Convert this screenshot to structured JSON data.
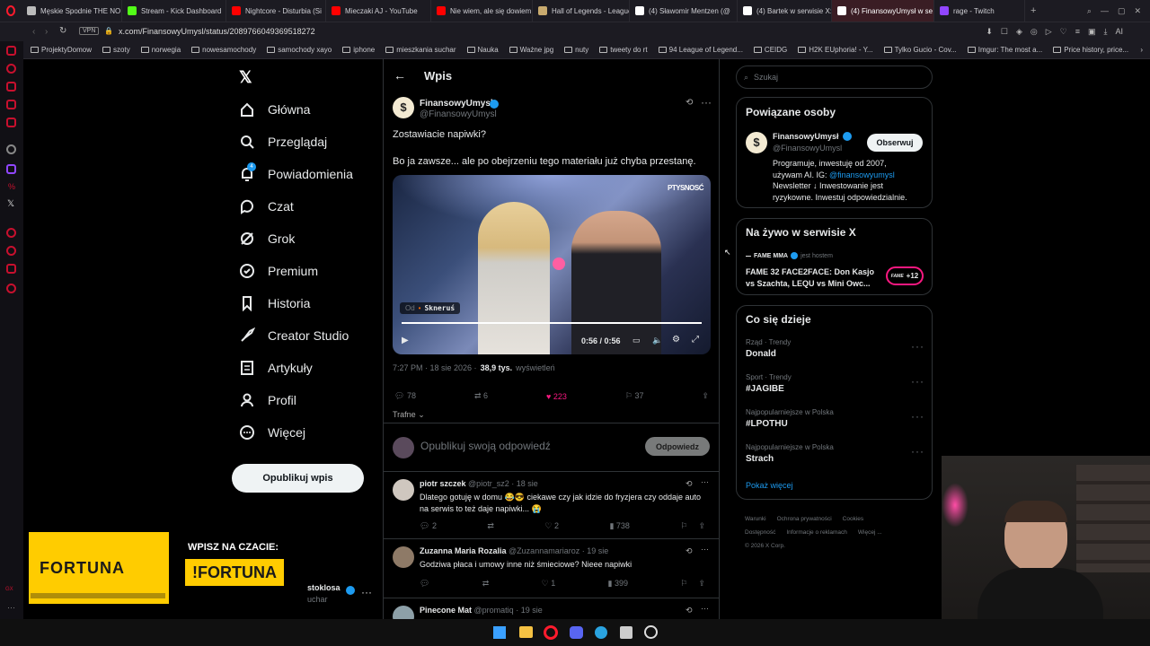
{
  "browser": {
    "tabs": [
      {
        "label": "Męskie Spodnie THE NO",
        "color": "#bbbbbb"
      },
      {
        "label": "Stream - Kick Dashboard",
        "color": "#53fc18"
      },
      {
        "label": "Nightcore - Disturbia (Si",
        "color": "#ff0000"
      },
      {
        "label": "Mieczaki AJ - YouTube",
        "color": "#ff0000"
      },
      {
        "label": "Nie wiem, ale się dowiem",
        "color": "#ff0000"
      },
      {
        "label": "Hall of Legends - League",
        "color": "#c8aa6e"
      },
      {
        "label": "(4) Sławomir Mentzen (@",
        "color": "#ffffff"
      },
      {
        "label": "(4) Bartek w serwisie X:",
        "color": "#ffffff"
      },
      {
        "label": "(4) FinansowyUmysł w se",
        "color": "#ffffff"
      },
      {
        "label": "rage - Twitch",
        "color": "#9146ff"
      }
    ],
    "vpn_label": "VPN",
    "url": "x.com/FinansowyUmysl/status/2089766049369518272",
    "ai_label": "AI",
    "bookmarks": [
      "ProjektyDomow",
      "szoty",
      "norwegia",
      "nowesamochody",
      "samochody xayo",
      "iphone",
      "mieszkania suchar",
      "Nauka",
      "Ważne jpg",
      "nuty",
      "tweety do rt",
      "94 League of Legend...",
      "CEIDG",
      "H2K EUphoria! - Y...",
      "Tylko Gucio - Cov...",
      "Imgur: The most a...",
      "Price history, price..."
    ]
  },
  "nav": {
    "items": [
      {
        "label": "Główna",
        "icon": "home-icon"
      },
      {
        "label": "Przeglądaj",
        "icon": "search-icon"
      },
      {
        "label": "Powiadomienia",
        "icon": "bell-icon",
        "badge": "4"
      },
      {
        "label": "Czat",
        "icon": "chat-icon"
      },
      {
        "label": "Grok",
        "icon": "grok-icon"
      },
      {
        "label": "Premium",
        "icon": "premium-icon"
      },
      {
        "label": "Historia",
        "icon": "bookmark-icon"
      },
      {
        "label": "Creator Studio",
        "icon": "rocket-icon"
      },
      {
        "label": "Artykuły",
        "icon": "article-icon"
      },
      {
        "label": "Profil",
        "icon": "profile-icon"
      },
      {
        "label": "Więcej",
        "icon": "more-icon"
      }
    ],
    "post_button": "Opublikuj wpis",
    "account_name": "stoklosa",
    "account_handle": "uchar"
  },
  "main": {
    "header_title": "Wpis",
    "author_name": "FinansowyUmysł",
    "author_handle": "@FinansowyUmysl",
    "text_line1": "Zostawiacie napiwki?",
    "text_line2": "Bo ja zawsze... ale po obejrzeniu tego materiału już chyba przestanę.",
    "video": {
      "from_label": "Od",
      "from_name": "Skneruś",
      "time": "0:56 / 0:56",
      "watermark": "PTYSNOSĆ",
      "progress": 1.0
    },
    "meta_time": "7:27 PM · 18 sie 2026 ·",
    "meta_views": "38,9 tys.",
    "meta_views_label": "wyświetleń",
    "stats": {
      "replies": "78",
      "reposts": "6",
      "likes": "223",
      "bookmarks": "37"
    },
    "sort_label": "Trafne",
    "reply_placeholder": "Opublikuj swoją odpowiedź",
    "reply_button": "Odpowiedz",
    "replies": [
      {
        "name": "piotr szczek",
        "handle": "@piotr_sz2",
        "date": "· 18 sie",
        "text": "Dlatego gotuję w domu 😂😎 ciekawe czy jak idzie do fryzjera czy oddaje auto na serwis to też daje napiwki... 😭",
        "replies": "2",
        "likes": "2",
        "views": "738"
      },
      {
        "name": "Zuzanna Maria Rozalia",
        "handle": "@Zuzannamariaroz",
        "date": "· 19 sie",
        "text": "Godziwa płaca i umowy inne niż śmieciowe? Nieee napiwki",
        "replies": "",
        "likes": "1",
        "views": "399"
      },
      {
        "name": "Pinecone Mat",
        "handle": "@promatiq",
        "date": "· 19 sie",
        "text": "",
        "replies": "",
        "likes": "",
        "views": ""
      }
    ]
  },
  "right": {
    "search_placeholder": "Szukaj",
    "related_title": "Powiązane osoby",
    "related": {
      "name": "FinansowyUmysł",
      "handle": "@FinansowyUmysl",
      "follow": "Obserwuj",
      "bio1": "Programuje, inwestuję od 2007,",
      "bio2": "używam AI. IG: ",
      "bio_link": "@finansowyumysl",
      "bio3": "Newsletter ↓ Inwestowanie jest",
      "bio4": "ryzykowne. Inwestuj odpowiedzialnie."
    },
    "live_title": "Na żywo w serwisie X",
    "live": {
      "host": "FAME MMA",
      "host_suffix": "jest hostem",
      "title": "FAME 32 FACE2FACE: Don Kasjo vs Szachta, LEQU vs Mini Owc...",
      "count": "+12"
    },
    "trends_title": "Co się dzieje",
    "trends": [
      {
        "tag": "Rząd · Trendy",
        "name": "Donald"
      },
      {
        "tag": "Sport · Trendy",
        "name": "#JAGIBE"
      },
      {
        "tag": "Najpopularniejsze w Polska",
        "name": "#LPOTHU"
      },
      {
        "tag": "Najpopularniejsze w Polska",
        "name": "Strach"
      }
    ],
    "show_more": "Pokaż więcej",
    "footer1": [
      "Warunki",
      "Ochrona prywatności",
      "Cookies"
    ],
    "footer2": [
      "Dostępność",
      "Informacje o reklamach",
      "Więcej ..."
    ],
    "copyright": "© 2026 X Corp."
  },
  "overlay": {
    "brand": "FORTUNA",
    "cta_top": "WPISZ NA CZACIE:",
    "cta_code": "!FORTUNA"
  }
}
